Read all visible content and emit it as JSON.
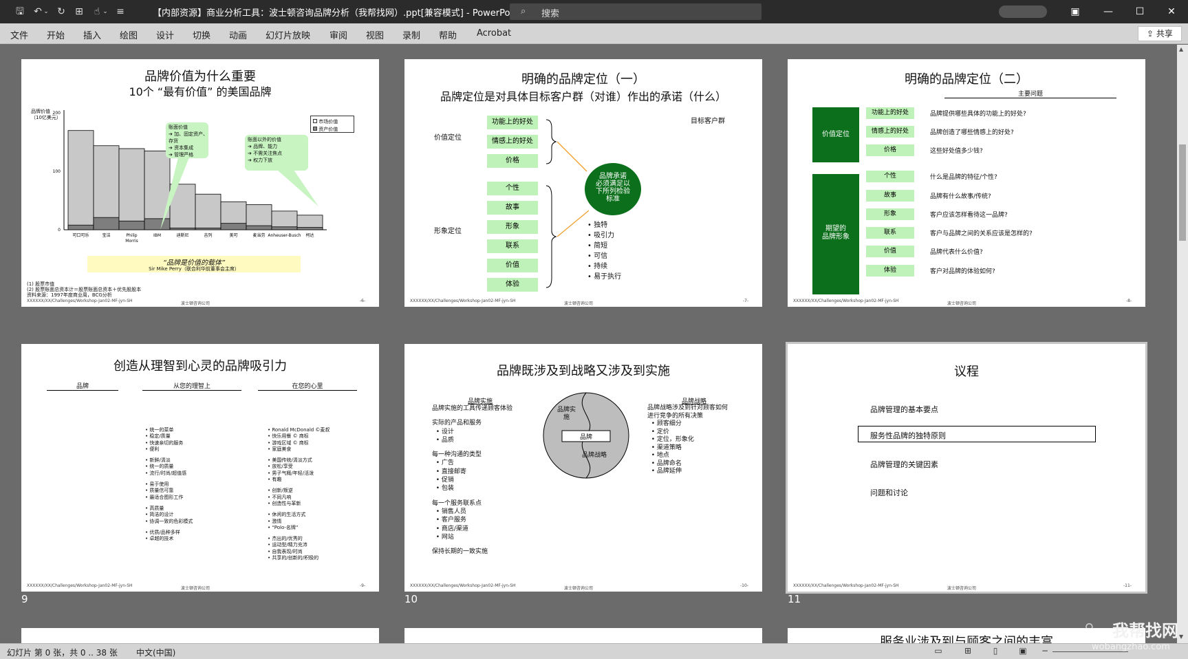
{
  "window": {
    "title": "【内部资源】商业分析工具：波士顿咨询品牌分析（我帮找网）.ppt[兼容模式] - PowerPoint",
    "search_placeholder": "搜索",
    "minimize": "—",
    "restore": "☐",
    "close": "✕",
    "ribbon_display": "▣"
  },
  "menu": {
    "items": [
      "文件",
      "开始",
      "插入",
      "绘图",
      "设计",
      "切换",
      "动画",
      "幻灯片放映",
      "审阅",
      "视图",
      "录制",
      "帮助",
      "Acrobat"
    ],
    "share": "共享"
  },
  "slides": {
    "s6": {
      "number": "6",
      "title1": "品牌价值为什么重要",
      "title2": "10个 “最有价值” 的美国品牌",
      "ylabel1": "品牌价值",
      "ylabel2": "（10亿美元）",
      "legend": [
        "市场价值",
        "资产价值"
      ],
      "callout1_title": "账面价值",
      "callout1_items": [
        "➔ 加、固定资产、",
        "    存货",
        "➔ 资本集成",
        "➔ 管理严格"
      ],
      "callout2_title": "账面以外的价值",
      "callout2_items": [
        "➔ 品牌、能力",
        "➔ 不需关注焦点",
        "➔ 权力下放"
      ],
      "quote": "“品牌是价值的载体”",
      "quote_author": "Sir Mike Perry（联合利华前董事会主席）",
      "notes": [
        "(1) 股票市值",
        "(2) 股票账面总资本计＝股票账面总资本＋优先股股本",
        "资料来源：1997年度商业周，BCG分析"
      ],
      "footer_left": "XXXXXX/XX/Challenges/Workshop-Jan02-MF-jyn-SH",
      "footer_center": "波士顿咨询公司",
      "page": "-6-"
    },
    "s7": {
      "number": "7",
      "title": "明确的品牌定位（一）",
      "subtitle": "品牌定位是对具体目标客户群（对谁）作出的承诺（什么）",
      "target_label": "目标客户群",
      "value_label": "价值定位",
      "image_label": "形象定位",
      "value_boxes": [
        "功能上的好处",
        "情感上的好处",
        "价格"
      ],
      "image_boxes": [
        "个性",
        "故事",
        "形象",
        "联系",
        "价值",
        "体验"
      ],
      "circle_text": [
        "品牌承诺",
        "必须满足以",
        "下所列检验",
        "标准"
      ],
      "bullets": [
        "独特",
        "吸引力",
        "简短",
        "可信",
        "持续",
        "易于执行"
      ],
      "footer_left": "XXXXXX/XX/Challenges/Workshop-Jan02-MF-jyn-SH",
      "footer_center": "波士顿咨询公司",
      "page": "-7-"
    },
    "s8": {
      "number": "8",
      "title": "明确的品牌定位（二）",
      "header": "主要问题",
      "value_label": "价值定位",
      "image_label": "期望的\n品牌形象",
      "items": [
        {
          "label": "功能上的好处",
          "q": "品牌提供哪些具体的功能上的好处?"
        },
        {
          "label": "情感上的好处",
          "q": "品牌创造了哪些情感上的好处?"
        },
        {
          "label": "价格",
          "q": "这些好处值多少钱?"
        },
        {
          "label": "个性",
          "q": "什么是品牌的特征/个性?"
        },
        {
          "label": "故事",
          "q": "品牌有什么故事/传统?"
        },
        {
          "label": "形象",
          "q": "客户应该怎样看待这一品牌?"
        },
        {
          "label": "联系",
          "q": "客户与品牌之间的关系应该是怎样的?"
        },
        {
          "label": "价值",
          "q": "品牌代表什么价值?"
        },
        {
          "label": "体验",
          "q": "客户对品牌的体验如何?"
        }
      ],
      "footer_left": "XXXXXX/XX/Challenges/Workshop-Jan02-MF-jyn-SH",
      "footer_center": "波士顿咨询公司",
      "page": "-8-"
    },
    "s9": {
      "number": "9",
      "title": "创造从理智到心灵的品牌吸引力",
      "col1": "品牌",
      "col2": "从您的理智上",
      "col3": "在您的心里",
      "left_lines": [
        "• 统一的菜单",
        "• 稳定/质量",
        "• 快速亲切的服务",
        "• 便利",
        "",
        "• 新鲜/清淡",
        "• 统一的质量",
        "• 流行/时尚/超值感",
        "",
        "• 易于使用",
        "• 质量信可靠",
        "• 最适合图形工作",
        "",
        "• 高质量",
        "• 简洁的设计",
        "• 协调一致的色彩模式",
        "",
        "• 优质/品种多样",
        "• 卓越的技术"
      ],
      "right_lines": [
        "• Ronald McDonald ©麦叔",
        "• 快乐用餐 © 商标",
        "• 游戏区域 © 商标",
        "• 家庭美食",
        "",
        "• 美国传统/清淡方式",
        "• 放松/享受",
        "• 男子气概/年轻/活泼",
        "• 有趣",
        "",
        "• 创新/叛逆",
        "• 不同凡响",
        "• 创造性与革新",
        "",
        "• 休闲的生活方式",
        "• 激情",
        "• “Polo-名牌”",
        "",
        "• 杰出的/优秀的",
        "• 运动型/精力充沛",
        "• 自我表现/时尚",
        "• 共享的/创新的/积极的"
      ],
      "footer_left": "XXXXXX/XX/Challenges/Workshop-Jan02-MF-jyn-SH",
      "footer_center": "波士顿咨询公司",
      "page": "-9-"
    },
    "s10": {
      "number": "10",
      "title": "品牌既涉及到战略又涉及到实施",
      "left_head": "品牌实施",
      "left_lines": [
        "品牌实施的工具传递顾客体验",
        "",
        "实际的产品和服务",
        "  • 设计",
        "  • 品质",
        "",
        "每一种沟通的类型",
        "  • 广告",
        "  • 直接邮寄",
        "  • 促销",
        "  • 包装",
        "",
        "每一个服务联系点",
        "  • 销售人员",
        "  • 客户服务",
        "  • 商店/渠道",
        "  • 网站",
        "",
        "保持长期的一致实施"
      ],
      "right_head": "品牌战略",
      "right_lines": [
        "品牌战略涉及到针对顾客如何",
        "进行竞争的所有决策",
        "  • 顾客细分",
        "  • 定价",
        "  • 定位，形象化",
        "  • 渠道策略",
        "  • 地点",
        "  • 品牌命名",
        "  • 品牌延伸"
      ],
      "circle_top": "品牌实\n施",
      "circle_center": "品牌",
      "circle_bottom": "品牌战略",
      "footer_left": "XXXXXX/XX/Challenges/Workshop-Jan02-MF-jyn-SH",
      "footer_center": "波士顿咨询公司",
      "page": "-10-"
    },
    "s11": {
      "number": "11",
      "title": "议程",
      "items": [
        "品牌管理的基本要点",
        "服务性品牌的独特原则",
        "品牌管理的关键因素",
        "问题和讨论"
      ],
      "footer_left": "XXXXXX/XX/Challenges/Workshop-Jan02-MF-jyn-SH",
      "footer_center": "波士顿咨询公司",
      "page": "-11-"
    },
    "s14": {
      "title_partial": "服务业涉及到与顾客之间的丰富"
    }
  },
  "chart_data": {
    "type": "bar",
    "categories": [
      "可口可乐",
      "宝洁",
      "Philip Morris",
      "IBM",
      "迪斯尼",
      "吉列",
      "美可",
      "麦当劳",
      "Anheuser-Busch",
      "柯达"
    ],
    "series": [
      {
        "name": "市场价值",
        "values": [
          170,
          144,
          139,
          135,
          78,
          61,
          48,
          43,
          32,
          25
        ]
      },
      {
        "name": "资产价值",
        "values": [
          8,
          21,
          15,
          19,
          3,
          3,
          11,
          7,
          5,
          4
        ]
      }
    ],
    "yticks": [
      0,
      100,
      200
    ],
    "ylim": [
      0,
      205
    ]
  },
  "statusbar": {
    "slide_info": "幻灯片 第 0 张，共 0 .. 38 张",
    "language": "中文(中国)"
  },
  "watermark": {
    "line1": "我帮找网",
    "line2": "wobangzhao.com"
  }
}
